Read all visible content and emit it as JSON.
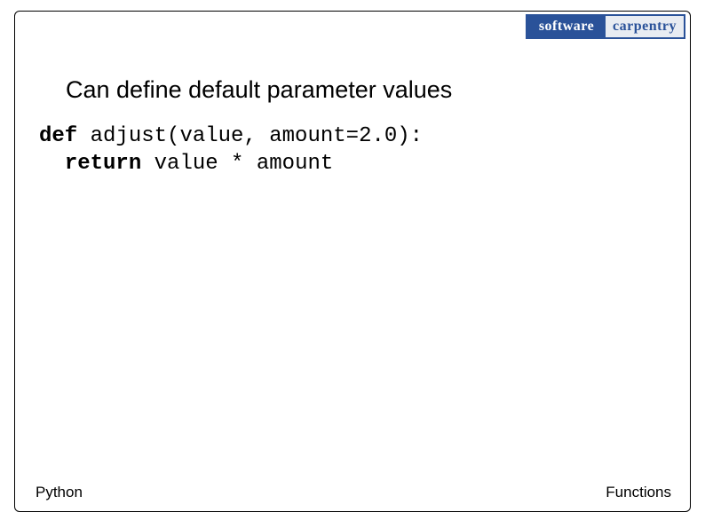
{
  "logo": {
    "left": "software",
    "right": "carpentry"
  },
  "heading": "Can define default parameter values",
  "code": {
    "kw_def": "def",
    "sig": " adjust(value, amount=2.0):",
    "indent": "  ",
    "kw_return": "return",
    "expr": " value * amount"
  },
  "footer": {
    "left": "Python",
    "right": "Functions"
  }
}
